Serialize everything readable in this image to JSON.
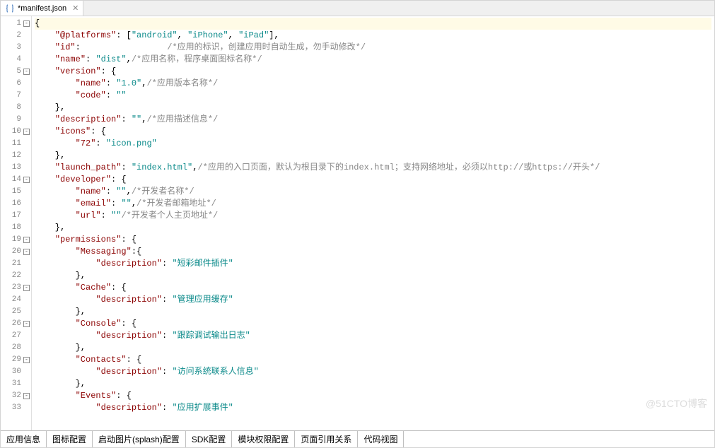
{
  "tab": {
    "title": "*manifest.json"
  },
  "watermark": "@51CTO博客",
  "bottom_tabs": [
    "应用信息",
    "图标配置",
    "启动图片(splash)配置",
    "SDK配置",
    "模块权限配置",
    "页面引用关系",
    "代码视图"
  ],
  "lines": [
    {
      "n": 1,
      "fold": "-",
      "html": "<span class='punct'>{</span>",
      "cls": "line1"
    },
    {
      "n": 2,
      "html": "    <span class='key'>\"@platforms\"</span>: [<span class='str'>\"android\"</span>, <span class='str'>\"iPhone\"</span>, <span class='str'>\"iPad\"</span>],"
    },
    {
      "n": 3,
      "html": "    <span class='key'>\"id\"</span>:                 <span class='comment'>/*应用的标识，创建应用时自动生成，勿手动修改*/</span>"
    },
    {
      "n": 4,
      "html": "    <span class='key'>\"name\"</span>: <span class='str'>\"dist\"</span>,<span class='comment'>/*应用名称，程序桌面图标名称*/</span>"
    },
    {
      "n": 5,
      "fold": "-",
      "html": "    <span class='key'>\"version\"</span>: {"
    },
    {
      "n": 6,
      "html": "        <span class='key'>\"name\"</span>: <span class='str'>\"1.0\"</span>,<span class='comment'>/*应用版本名称*/</span>"
    },
    {
      "n": 7,
      "html": "        <span class='key'>\"code\"</span>: <span class='str'>\"\"</span>"
    },
    {
      "n": 8,
      "html": "    },"
    },
    {
      "n": 9,
      "html": "    <span class='key'>\"description\"</span>: <span class='str'>\"\"</span>,<span class='comment'>/*应用描述信息*/</span>"
    },
    {
      "n": 10,
      "fold": "-",
      "html": "    <span class='key'>\"icons\"</span>: {"
    },
    {
      "n": 11,
      "html": "        <span class='key'>\"72\"</span>: <span class='str'>\"icon.png\"</span>"
    },
    {
      "n": 12,
      "html": "    },"
    },
    {
      "n": 13,
      "html": "    <span class='key'>\"launch_path\"</span>: <span class='str'>\"index.html\"</span>,<span class='comment'>/*应用的入口页面，默认为根目录下的index.html；支持网络地址，必须以http://或https://开头*/</span>"
    },
    {
      "n": 14,
      "fold": "-",
      "html": "    <span class='key'>\"developer\"</span>: {"
    },
    {
      "n": 15,
      "html": "        <span class='key'>\"name\"</span>: <span class='str'>\"\"</span>,<span class='comment'>/*开发者名称*/</span>"
    },
    {
      "n": 16,
      "html": "        <span class='key'>\"email\"</span>: <span class='str'>\"\"</span>,<span class='comment'>/*开发者邮箱地址*/</span>"
    },
    {
      "n": 17,
      "html": "        <span class='key'>\"url\"</span>: <span class='str'>\"\"</span><span class='comment'>/*开发者个人主页地址*/</span>"
    },
    {
      "n": 18,
      "html": "    },"
    },
    {
      "n": 19,
      "fold": "-",
      "html": "    <span class='key'>\"permissions\"</span>: {"
    },
    {
      "n": 20,
      "fold": "-",
      "html": "        <span class='key'>\"Messaging\"</span>:{"
    },
    {
      "n": 21,
      "html": "            <span class='key'>\"description\"</span>: <span class='str'>\"短彩邮件插件\"</span>"
    },
    {
      "n": 22,
      "html": "        },"
    },
    {
      "n": 23,
      "fold": "-",
      "html": "        <span class='key'>\"Cache\"</span>: {"
    },
    {
      "n": 24,
      "html": "            <span class='key'>\"description\"</span>: <span class='str'>\"管理应用缓存\"</span>"
    },
    {
      "n": 25,
      "html": "        },"
    },
    {
      "n": 26,
      "fold": "-",
      "html": "        <span class='key'>\"Console\"</span>: {"
    },
    {
      "n": 27,
      "html": "            <span class='key'>\"description\"</span>: <span class='str'>\"跟踪调试输出日志\"</span>"
    },
    {
      "n": 28,
      "html": "        },"
    },
    {
      "n": 29,
      "fold": "-",
      "html": "        <span class='key'>\"Contacts\"</span>: {"
    },
    {
      "n": 30,
      "html": "            <span class='key'>\"description\"</span>: <span class='str'>\"访问系统联系人信息\"</span>"
    },
    {
      "n": 31,
      "html": "        },"
    },
    {
      "n": 32,
      "fold": "-",
      "html": "        <span class='key'>\"Events\"</span>: {"
    },
    {
      "n": 33,
      "html": "            <span class='key'>\"description\"</span>: <span class='str'>\"应用扩展事件\"</span>"
    }
  ]
}
